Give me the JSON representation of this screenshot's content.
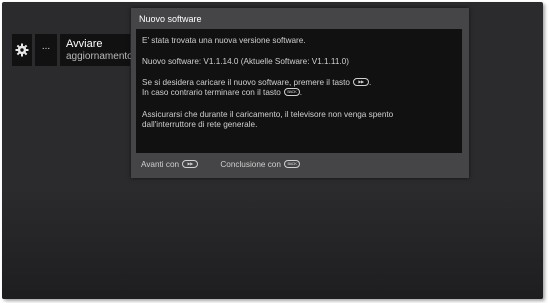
{
  "menu": {
    "more_label": "...",
    "update_line1": "Avviare",
    "update_line2": "aggiornamento"
  },
  "dialog": {
    "title": "Nuovo software",
    "message_found": "E' stata trovata una nuova versione software.",
    "version_line": "Nuovo software:  V1.1.14.0  (Aktuelle Software:  V1.1.11.0)",
    "load_instruction": "Se si desidera caricare il nuovo software, premere il tasto",
    "load_instruction_end": ".",
    "cancel_instruction": "In caso contrario terminare con il tasto",
    "cancel_instruction_end": ".",
    "warning_line1": "Assicurarsi che durante il caricamento, il televisore non venga spento",
    "warning_line2": "dall'interruttore di rete generale.",
    "footer_forward": "Avanti con",
    "footer_end": "Conclusione con"
  },
  "icons": {
    "settings": "gear-icon",
    "play_key": "play-key-icon",
    "back_key": "back-key-icon"
  },
  "colors": {
    "screen_bg": "#2b2b2d",
    "dialog_bg": "#454547",
    "dialog_body_bg": "#111112",
    "text": "#d0d0d0"
  },
  "keys": {
    "play": "▶▶",
    "back": "BACK"
  }
}
